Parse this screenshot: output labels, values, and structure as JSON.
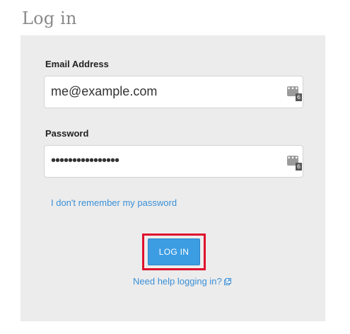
{
  "page": {
    "title": "Log in"
  },
  "email": {
    "label": "Email Address",
    "value": "me@example.com"
  },
  "password": {
    "label": "Password",
    "value": "••••••••••••••••"
  },
  "password_manager": {
    "icon": "password-manager-icon",
    "dots": "•••",
    "count": "6"
  },
  "links": {
    "forgot_password": "I don't remember my password",
    "help": "Need help logging in?"
  },
  "login_button": {
    "label": "LOG IN"
  },
  "colors": {
    "accent": "#3c9de3",
    "link": "#3a8fd6",
    "highlight": "#e0102e",
    "panel": "#ececec"
  }
}
